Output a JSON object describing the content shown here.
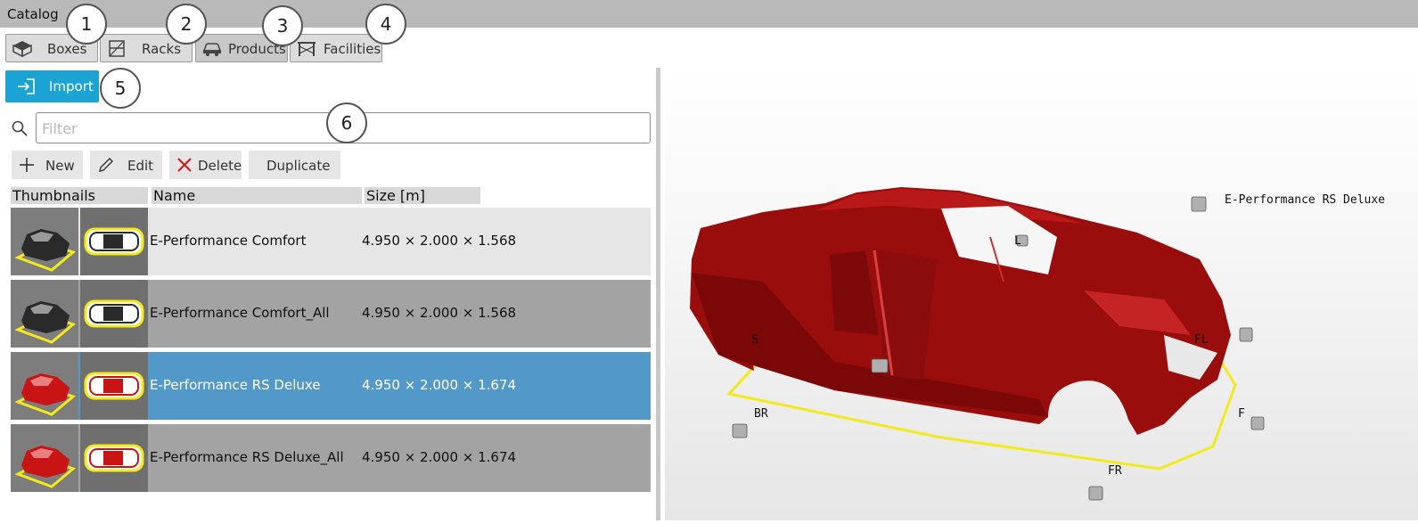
{
  "window": {
    "title": "Catalog"
  },
  "tabs": [
    {
      "label": "Boxes",
      "icon": "box-icon"
    },
    {
      "label": "Racks",
      "icon": "rack-icon"
    },
    {
      "label": "Products",
      "icon": "car-icon",
      "active": true
    },
    {
      "label": "Facilities",
      "icon": "facility-icon"
    }
  ],
  "import": {
    "label": "Import",
    "icon": "import-icon"
  },
  "filter": {
    "placeholder": "Filter",
    "value": ""
  },
  "toolbar": {
    "new_label": "New",
    "edit_label": "Edit",
    "delete_label": "Delete",
    "duplicate_label": "Duplicate"
  },
  "table": {
    "headers": [
      "Thumbnails",
      "Name",
      "Size [m]"
    ],
    "rows": [
      {
        "name": "E-Performance Comfort",
        "size": "4.950 × 2.000 × 1.568",
        "color": "#2a2a2a"
      },
      {
        "name": "E-Performance Comfort_All",
        "size": "4.950 × 2.000 × 1.568",
        "color": "#2a2a2a"
      },
      {
        "name": "E-Performance RS Deluxe",
        "size": "4.950 × 2.000 × 1.674",
        "color": "#c81414",
        "selected": true
      },
      {
        "name": "E-Performance RS Deluxe_All",
        "size": "4.950 × 2.000 × 1.674",
        "color": "#c81414"
      }
    ]
  },
  "viewport": {
    "title_label": "E-Performance RS Deluxe",
    "point_labels": {
      "L": "L",
      "FL": "FL",
      "S": "S",
      "BR": "BR",
      "F": "F",
      "FR": "FR"
    },
    "car_color": "#9a0d0d",
    "footprint_color": "#f2ea1c"
  },
  "callouts": [
    "1",
    "2",
    "3",
    "4",
    "5",
    "6"
  ],
  "colors": {
    "selected_row": "#5298c8",
    "row_light": "#e6e6e6",
    "row_dark": "#a3a3a3",
    "accent": "#1ba3d3"
  }
}
